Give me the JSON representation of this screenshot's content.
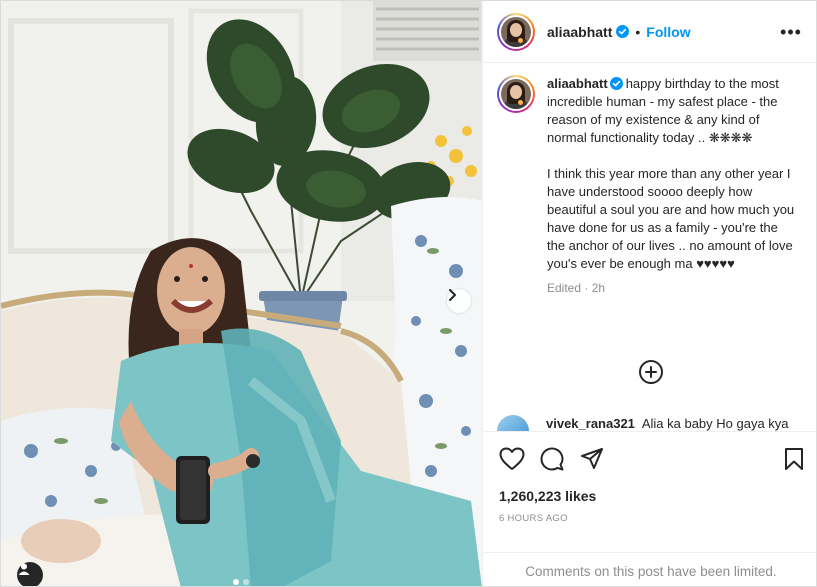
{
  "post": {
    "username": "aliaabhatt",
    "separator": "•",
    "follow_label": "Follow",
    "more_label": "•••",
    "caption_para1": "happy birthday to the most incredible human - my safest place - the reason of my existence & any kind of normal functionality today .. ❋❋❋❋",
    "caption_para2": "I think this year more than any other year I have understood soooo deeply how beautiful a soul you are and how much you have done for us as a family - you're the the anchor of our lives .. no amount of love you's ever be enough ma ♥♥♥♥♥",
    "edited_label": "Edited",
    "edited_dot": "·",
    "edited_time": "2h",
    "likes_text": "1,260,223 likes",
    "time_ago": "6 HOURS AGO",
    "comments_limited": "Comments on this post have been limited."
  },
  "comment_peek": {
    "username": "vivek_rana321",
    "text": "Alia ka baby  Ho gaya kya"
  },
  "carousel": {
    "current": 1,
    "total": 2
  },
  "icons": {
    "verified": "verified-badge-icon",
    "more": "more-options-icon",
    "load_more": "plus-circle-icon",
    "like": "heart-icon",
    "comment": "comment-bubble-icon",
    "share": "paper-plane-icon",
    "save": "bookmark-icon",
    "next": "chevron-right-icon",
    "tag": "user-tag-icon"
  },
  "colors": {
    "accent": "#0095f6",
    "text": "#262626",
    "muted": "#8e8e8e",
    "border": "#efefef"
  }
}
